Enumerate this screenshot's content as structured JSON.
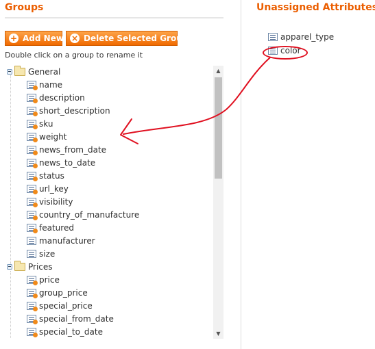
{
  "groups_panel": {
    "title": "Groups",
    "add_new_label": "Add New",
    "delete_label": "Delete Selected Group",
    "hint": "Double click on a group to rename it"
  },
  "tree": {
    "groups": [
      {
        "name": "General",
        "attributes": [
          {
            "label": "name",
            "icon": "user-attribute-icon"
          },
          {
            "label": "description",
            "icon": "user-attribute-icon"
          },
          {
            "label": "short_description",
            "icon": "user-attribute-icon"
          },
          {
            "label": "sku",
            "icon": "user-attribute-icon"
          },
          {
            "label": "weight",
            "icon": "user-attribute-icon"
          },
          {
            "label": "news_from_date",
            "icon": "user-attribute-icon"
          },
          {
            "label": "news_to_date",
            "icon": "user-attribute-icon"
          },
          {
            "label": "status",
            "icon": "user-attribute-icon"
          },
          {
            "label": "url_key",
            "icon": "user-attribute-icon"
          },
          {
            "label": "visibility",
            "icon": "user-attribute-icon"
          },
          {
            "label": "country_of_manufacture",
            "icon": "user-attribute-icon"
          },
          {
            "label": "featured",
            "icon": "user-attribute-icon"
          },
          {
            "label": "manufacturer",
            "icon": "attribute-icon"
          },
          {
            "label": "size",
            "icon": "attribute-icon"
          }
        ]
      },
      {
        "name": "Prices",
        "attributes": [
          {
            "label": "price",
            "icon": "user-attribute-icon"
          },
          {
            "label": "group_price",
            "icon": "user-attribute-icon"
          },
          {
            "label": "special_price",
            "icon": "user-attribute-icon"
          },
          {
            "label": "special_from_date",
            "icon": "user-attribute-icon"
          },
          {
            "label": "special_to_date",
            "icon": "user-attribute-icon"
          }
        ]
      }
    ]
  },
  "unassigned_panel": {
    "title": "Unassigned Attributes",
    "attributes": [
      {
        "label": "apparel_type",
        "icon": "attribute-icon"
      },
      {
        "label": "color",
        "icon": "attribute-icon"
      }
    ]
  },
  "colors": {
    "title_orange": "#eb5e00",
    "button_orange": "#f18200",
    "annotation_red": "#e01020"
  }
}
